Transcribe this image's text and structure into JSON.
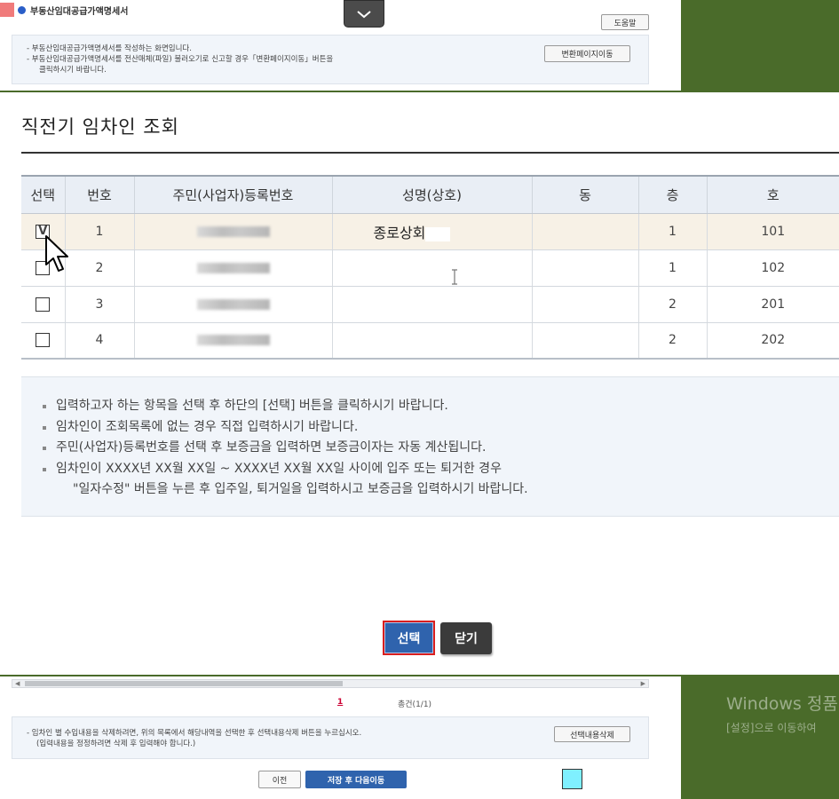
{
  "background_page": {
    "title": "부동산임대공급가액명세서",
    "help_button": "도움말",
    "info_lines": [
      "부동산임대공급가액명세서를 작성하는 화면입니다.",
      "부동산임대공급가액명세서를 전산매체(파일) 불러오기로 신고할 경우「변환페이지이동」버튼을",
      "클릭하시기 바랍니다."
    ],
    "convert_button": "변환페이지이동",
    "pagination": {
      "current": "1",
      "total": "총건(1/1)"
    },
    "bottom_info_lines": [
      "임차인 별 수입내용을 삭제하려면, 위의 목록에서 해당내역을 선택한 후 선택내용삭제 버튼을 누르십시오.",
      "(입력내용을 정정하려면 삭제 후 입력해야 합니다.)"
    ],
    "delete_button": "선택내용삭제",
    "prev_button": "이전",
    "save_next_button": "저장 후 다음이동"
  },
  "modal": {
    "title": "직전기 임차인 조회",
    "columns": [
      "선택",
      "번호",
      "주민(사업자)등록번호",
      "성명(상호)",
      "동",
      "층",
      "호"
    ],
    "rows": [
      {
        "checked": "V",
        "no": "1",
        "name": "종로상회",
        "dong": "",
        "floor": "1",
        "ho": "101"
      },
      {
        "checked": "",
        "no": "2",
        "name": "",
        "dong": "",
        "floor": "1",
        "ho": "102"
      },
      {
        "checked": "",
        "no": "3",
        "name": "",
        "dong": "",
        "floor": "2",
        "ho": "201"
      },
      {
        "checked": "",
        "no": "4",
        "name": "",
        "dong": "",
        "floor": "2",
        "ho": "202"
      }
    ],
    "instructions": [
      "입력하고자 하는 항목을 선택 후 하단의 [선택] 버튼을 클릭하시기 바랍니다.",
      "임차인이 조회목록에 없는 경우 직접 입력하시기 바랍니다.",
      "주민(사업자)등록번호를 선택 후 보증금을 입력하면 보증금이자는 자동 계산됩니다.",
      "임차인이 XXXX년 XX월 XX일 ~ XXXX년 XX월 XX일 사이에 입주 또는 퇴거한 경우",
      "\"일자수정\" 버튼을 누른 후 입주일, 퇴거일을 입력하시고 보증금을 입력하시기 바랍니다."
    ],
    "select_button": "선택",
    "close_button": "닫기"
  },
  "watermark": {
    "line1": "Windows 정품",
    "line2": "[설정]으로 이동하여"
  },
  "colors": {
    "primary_button": "#2f63ad",
    "highlight_border": "#d91e1e",
    "desktop": "#4a6b2a",
    "selected_row": "#f7f1e6",
    "info_box": "#f1f5fa"
  }
}
